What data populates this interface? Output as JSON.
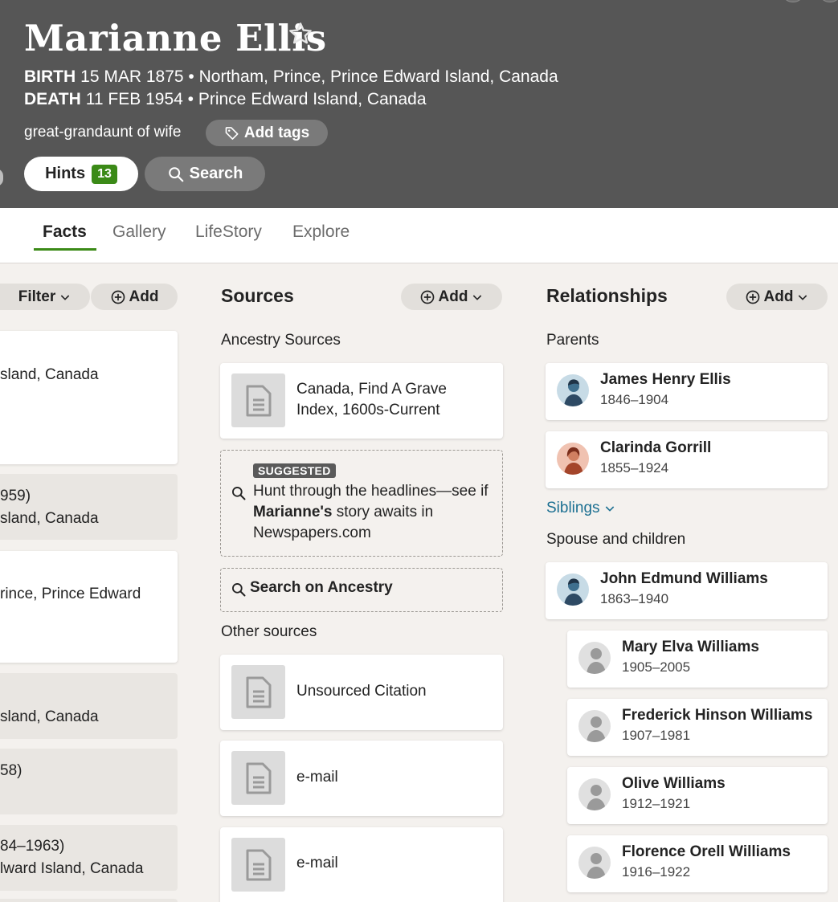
{
  "person": {
    "name": "Marianne Ellis",
    "birth_label": "BIRTH",
    "birth_value": "15 MAR 1875 • Northam, Prince, Prince Edward Island, Canada",
    "death_label": "DEATH",
    "death_value": "11 FEB 1954 • Prince Edward Island, Canada",
    "relationship": "great-grandaunt of wife",
    "add_tags_label": "Add tags",
    "hints_label": "Hints",
    "hints_count": "13",
    "search_label": "Search"
  },
  "tabs": [
    {
      "label": "Facts",
      "active": true
    },
    {
      "label": "Gallery",
      "active": false
    },
    {
      "label": "LifeStory",
      "active": false
    },
    {
      "label": "Explore",
      "active": false
    }
  ],
  "facts": {
    "filter_label": "Filter",
    "add_label": "Add",
    "cards": [
      {
        "lines": [
          "sland, Canada"
        ]
      },
      {
        "lines": [
          "959)",
          "sland, Canada"
        ]
      },
      {
        "lines": [
          "rince, Prince Edward"
        ]
      },
      {
        "lines": [
          "sland, Canada"
        ]
      },
      {
        "lines": [
          "58)"
        ]
      },
      {
        "lines": [
          "84–1963)",
          "lward Island, Canada"
        ]
      }
    ]
  },
  "sources": {
    "title": "Sources",
    "add_label": "Add",
    "ancestry_label": "Ancestry Sources",
    "ancestry_items": [
      {
        "title": "Canada, Find A Grave Index, 1600s-Current"
      }
    ],
    "suggested": {
      "badge": "SUGGESTED",
      "text_before": "Hunt through the headlines—see if ",
      "text_bold": "Marianne's",
      "text_after": " story awaits in Newspapers.com"
    },
    "search_ancestry_label": "Search on Ancestry",
    "other_label": "Other sources",
    "other_items": [
      {
        "title": "Unsourced Citation"
      },
      {
        "title": "e-mail"
      },
      {
        "title": "e-mail"
      }
    ]
  },
  "relationships": {
    "title": "Relationships",
    "add_label": "Add",
    "parents_label": "Parents",
    "parents": [
      {
        "name": "James Henry Ellis",
        "dates": "1846–1904",
        "gender": "male"
      },
      {
        "name": "Clarinda Gorrill",
        "dates": "1855–1924",
        "gender": "female"
      }
    ],
    "siblings_label": "Siblings",
    "spouse_label": "Spouse and children",
    "spouse": {
      "name": "John Edmund Williams",
      "dates": "1863–1940",
      "gender": "male"
    },
    "children": [
      {
        "name": "Mary Elva Williams",
        "dates": "1905–2005",
        "gender": "unknown"
      },
      {
        "name": "Frederick Hinson Williams",
        "dates": "1907–1981",
        "gender": "unknown"
      },
      {
        "name": "Olive Williams",
        "dates": "1912–1921",
        "gender": "unknown"
      },
      {
        "name": "Florence Orell Williams",
        "dates": "1916–1922",
        "gender": "unknown"
      }
    ]
  },
  "colors": {
    "header_bg": "#565656",
    "accent_green": "#3b8a17",
    "link_blue": "#1b6f91",
    "page_bg": "#f4f1ee"
  }
}
